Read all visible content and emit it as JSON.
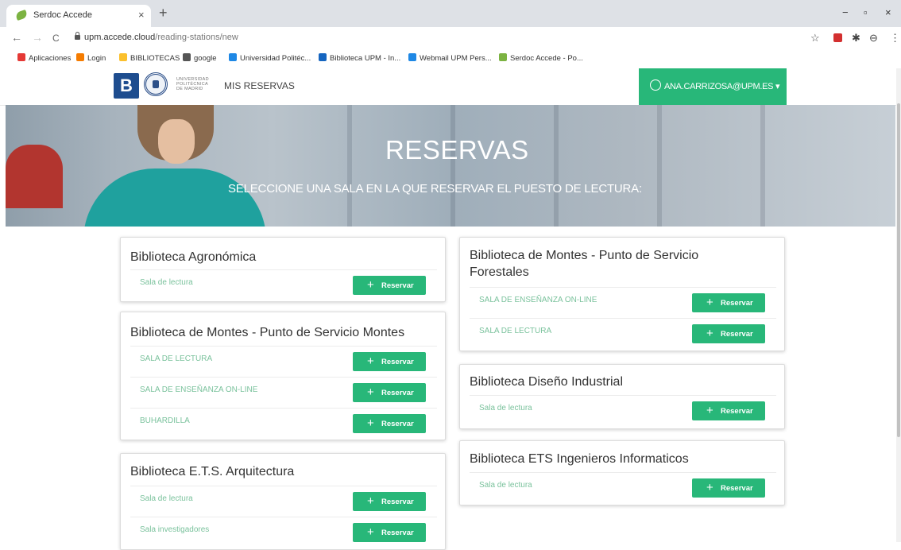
{
  "browser": {
    "tab_title": "Serdoc Accede",
    "tab_close": "×",
    "new_tab": "+",
    "window_controls": [
      "−",
      "▫",
      "×"
    ],
    "nav": [
      "←",
      "→",
      "C"
    ],
    "url_host": "upm.accede.cloud",
    "url_path": "/reading-stations/new",
    "toolbar_icons": [
      "☆",
      "✱",
      "⊖",
      "⋮"
    ]
  },
  "bookmarks": [
    {
      "label": "Aplicaciones",
      "color": "#e53935"
    },
    {
      "label": "Login",
      "color": "#f57c00"
    },
    {
      "label": "BIBLIOTECAS",
      "color": "#fbc02d"
    },
    {
      "label": "google",
      "color": "#555555"
    },
    {
      "label": "Universidad Politéc...",
      "color": "#1e88e5"
    },
    {
      "label": "Biblioteca UPM - In...",
      "color": "#1565c0"
    },
    {
      "label": "Webmail UPM Pers...",
      "color": "#1e88e5"
    },
    {
      "label": "Serdoc Accede - Po...",
      "color": "#7cb342"
    }
  ],
  "header": {
    "logo_letter": "B",
    "uni_lines": [
      "UNIVERSIDAD",
      "POLITÉCNICA",
      "DE MADRID"
    ],
    "nav_label": "MIS RESERVAS",
    "user_email": "ANA.CARRIZOSA@UPM.ES"
  },
  "hero": {
    "title": "RESERVAS",
    "subtitle": "SELECCIONE UNA SALA EN LA QUE RESERVAR EL PUESTO DE LECTURA:"
  },
  "button_label": "Reservar",
  "libraries": [
    {
      "name": "Biblioteca Agronómica",
      "rooms": [
        "Sala de lectura"
      ]
    },
    {
      "name": "Biblioteca de Montes - Punto de Servicio Montes",
      "rooms": [
        "SALA DE LECTURA",
        "SALA DE ENSEÑANZA ON-LINE",
        "BUHARDILLA"
      ]
    },
    {
      "name": "Biblioteca E.T.S. Arquitectura",
      "rooms": [
        "Sala de lectura",
        "Sala investigadores"
      ]
    },
    {
      "name": "Biblioteca de Montes - Punto de Servicio Forestales",
      "rooms": [
        "SALA DE ENSEÑANZA ON-LINE",
        "SALA DE LECTURA"
      ]
    },
    {
      "name": "Biblioteca Diseño Industrial",
      "rooms": [
        "Sala de lectura"
      ]
    },
    {
      "name": "Biblioteca ETS Ingenieros Informaticos",
      "rooms": [
        "Sala de lectura"
      ]
    }
  ],
  "colors": {
    "accent": "#28b779",
    "room_link": "#7ac29c",
    "brand_blue": "#1e4d8f"
  }
}
